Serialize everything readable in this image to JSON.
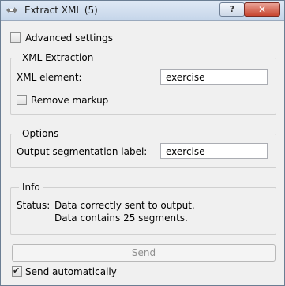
{
  "window": {
    "title": "Extract XML (5)",
    "help_button_label": "?",
    "close_button_label": "✕"
  },
  "advanced_settings": {
    "label": "Advanced settings",
    "checked": false
  },
  "xml_extraction": {
    "title": "XML Extraction",
    "element_label": "XML element:",
    "element_value": "exercise",
    "remove_markup_label": "Remove markup",
    "remove_markup_checked": false
  },
  "options": {
    "title": "Options",
    "output_label": "Output segmentation label:",
    "output_value": "exercise"
  },
  "info": {
    "title": "Info",
    "status_label": "Status:",
    "line1": "Data correctly sent to output.",
    "line2": "Data contains 25 segments."
  },
  "send": {
    "label": "Send"
  },
  "send_automatically": {
    "label": "Send automatically",
    "checked": true
  }
}
